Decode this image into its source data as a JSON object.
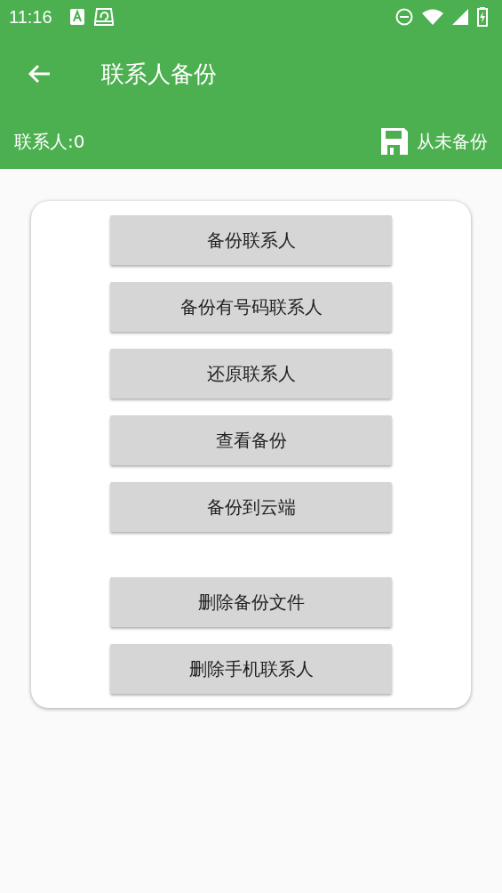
{
  "status_bar": {
    "time": "11:16"
  },
  "toolbar": {
    "title": "联系人备份"
  },
  "info_bar": {
    "contact_count": "联系人:0",
    "backup_status": "从未备份"
  },
  "button_groups": [
    {
      "buttons": [
        "备份联系人",
        "备份有号码联系人",
        "还原联系人",
        "查看备份",
        "备份到云端"
      ]
    },
    {
      "buttons": [
        "删除备份文件",
        "删除手机联系人"
      ]
    }
  ]
}
